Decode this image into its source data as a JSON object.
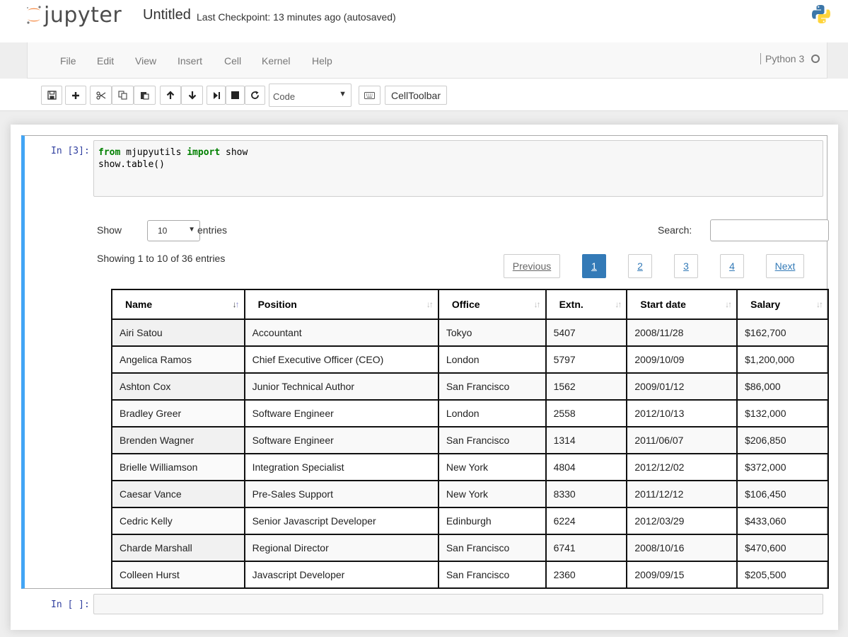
{
  "header": {
    "logo_text": "jupyter",
    "notebook_name": "Untitled",
    "checkpoint": "Last Checkpoint: 13 minutes ago (autosaved)"
  },
  "menu": {
    "items": [
      "File",
      "Edit",
      "View",
      "Insert",
      "Cell",
      "Kernel",
      "Help"
    ],
    "kernel_name": "Python 3"
  },
  "toolbar": {
    "cell_type": "Code",
    "celltoolbar_label": "CellToolbar"
  },
  "cells": {
    "cell1_prompt": "In [3]:",
    "cell1_code_line1_kw1": "from",
    "cell1_code_line1_mod": " mjupyutils ",
    "cell1_code_line1_kw2": "import",
    "cell1_code_line1_name": " show",
    "cell1_code_line2": "show.table()",
    "cell2_prompt": "In [ ]:"
  },
  "datatable": {
    "show_label": "Show",
    "entries_label": "entries",
    "page_length": "10",
    "search_label": "Search:",
    "info": "Showing 1 to 10 of 36 entries",
    "pagination": {
      "previous": "Previous",
      "pages": [
        "1",
        "2",
        "3",
        "4"
      ],
      "current": "1",
      "next": "Next"
    },
    "columns": [
      "Name",
      "Position",
      "Office",
      "Extn.",
      "Start date",
      "Salary"
    ],
    "rows": [
      [
        "Airi Satou",
        "Accountant",
        "Tokyo",
        "5407",
        "2008/11/28",
        "$162,700"
      ],
      [
        "Angelica Ramos",
        "Chief Executive Officer (CEO)",
        "London",
        "5797",
        "2009/10/09",
        "$1,200,000"
      ],
      [
        "Ashton Cox",
        "Junior Technical Author",
        "San Francisco",
        "1562",
        "2009/01/12",
        "$86,000"
      ],
      [
        "Bradley Greer",
        "Software Engineer",
        "London",
        "2558",
        "2012/10/13",
        "$132,000"
      ],
      [
        "Brenden Wagner",
        "Software Engineer",
        "San Francisco",
        "1314",
        "2011/06/07",
        "$206,850"
      ],
      [
        "Brielle Williamson",
        "Integration Specialist",
        "New York",
        "4804",
        "2012/12/02",
        "$372,000"
      ],
      [
        "Caesar Vance",
        "Pre-Sales Support",
        "New York",
        "8330",
        "2011/12/12",
        "$106,450"
      ],
      [
        "Cedric Kelly",
        "Senior Javascript Developer",
        "Edinburgh",
        "6224",
        "2012/03/29",
        "$433,060"
      ],
      [
        "Charde Marshall",
        "Regional Director",
        "San Francisco",
        "6741",
        "2008/10/16",
        "$470,600"
      ],
      [
        "Colleen Hurst",
        "Javascript Developer",
        "San Francisco",
        "2360",
        "2009/09/15",
        "$205,500"
      ]
    ]
  }
}
